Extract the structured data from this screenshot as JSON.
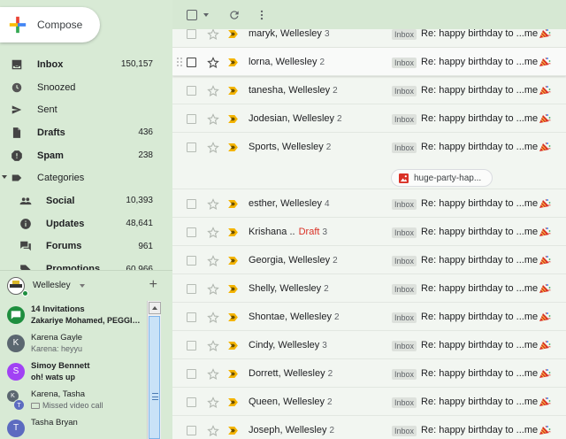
{
  "compose": {
    "label": "Compose"
  },
  "labels": [
    {
      "id": "inbox",
      "icon": "inbox-icon",
      "name": "Inbox",
      "count": "150,157",
      "bold": true
    },
    {
      "id": "snoozed",
      "icon": "clock-icon",
      "name": "Snoozed",
      "count": "",
      "bold": false
    },
    {
      "id": "sent",
      "icon": "send-icon",
      "name": "Sent",
      "count": "",
      "bold": false
    },
    {
      "id": "drafts",
      "icon": "draft-icon",
      "name": "Drafts",
      "count": "436",
      "bold": true
    },
    {
      "id": "spam",
      "icon": "spam-icon",
      "name": "Spam",
      "count": "238",
      "bold": true
    },
    {
      "id": "categories",
      "icon": "label-icon",
      "name": "Categories",
      "count": "",
      "bold": false
    },
    {
      "id": "social",
      "icon": "people-icon",
      "name": "Social",
      "count": "10,393",
      "bold": true,
      "sub": true
    },
    {
      "id": "updates",
      "icon": "info-icon",
      "name": "Updates",
      "count": "48,641",
      "bold": true,
      "sub": true
    },
    {
      "id": "forums",
      "icon": "forum-icon",
      "name": "Forums",
      "count": "961",
      "bold": true,
      "sub": true
    },
    {
      "id": "promotions",
      "icon": "tag-icon",
      "name": "Promotions",
      "count": "60,966",
      "bold": true,
      "sub": true
    }
  ],
  "chat": {
    "account_name": "Wellesley",
    "conversations": [
      {
        "type": "group",
        "title": "14 Invitations",
        "subtitle": "Zakariye Mohamed, PEGGI…",
        "bold": true,
        "color": "#1e8e3e",
        "initial": ""
      },
      {
        "type": "person",
        "title": "Karena Gayle",
        "subtitle": "Karena: heyyu",
        "bold": false,
        "color": "#5b6770",
        "initial": "K"
      },
      {
        "type": "person",
        "title": "Simoy Bennett",
        "subtitle": "oh! wats up",
        "bold": true,
        "color": "#a142f4",
        "initial": "S"
      },
      {
        "type": "pair",
        "title": "Karena, Tasha",
        "subtitle": "Missed video call",
        "bold": false,
        "initial": "K",
        "initial2": "T"
      },
      {
        "type": "person",
        "title": "Tasha Bryan",
        "subtitle": "",
        "bold": false,
        "color": "#5c6bc0",
        "initial": "T"
      }
    ]
  },
  "emails": [
    {
      "sender": "maryk, Wellesley",
      "count": "3",
      "draft": "",
      "tag": "Inbox",
      "subject": "Re: happy birthday to ...me",
      "hover": false
    },
    {
      "sender": "lorna, Wellesley",
      "count": "2",
      "draft": "",
      "tag": "Inbox",
      "subject": "Re: happy birthday to ...me",
      "hover": true
    },
    {
      "sender": "tanesha, Wellesley",
      "count": "2",
      "draft": "",
      "tag": "Inbox",
      "subject": "Re: happy birthday to ...me",
      "hover": false
    },
    {
      "sender": "Jodesian, Wellesley",
      "count": "2",
      "draft": "",
      "tag": "Inbox",
      "subject": "Re: happy birthday to ...me",
      "hover": false
    },
    {
      "sender": "Sports, Wellesley",
      "count": "2",
      "draft": "",
      "tag": "Inbox",
      "subject": "Re: happy birthday to ...me",
      "hover": false,
      "attachment": "huge-party-hap..."
    },
    {
      "sender": "esther, Wellesley",
      "count": "4",
      "draft": "",
      "tag": "Inbox",
      "subject": "Re: happy birthday to ...me",
      "hover": false
    },
    {
      "sender": "Krishana ..",
      "count": "3",
      "draft": "Draft",
      "tag": "Inbox",
      "subject": "Re: happy birthday to ...me",
      "hover": false
    },
    {
      "sender": "Georgia, Wellesley",
      "count": "2",
      "draft": "",
      "tag": "Inbox",
      "subject": "Re: happy birthday to ...me",
      "hover": false
    },
    {
      "sender": "Shelly, Wellesley",
      "count": "2",
      "draft": "",
      "tag": "Inbox",
      "subject": "Re: happy birthday to ...me",
      "hover": false
    },
    {
      "sender": "Shontae, Wellesley",
      "count": "2",
      "draft": "",
      "tag": "Inbox",
      "subject": "Re: happy birthday to ...me",
      "hover": false
    },
    {
      "sender": "Cindy, Wellesley",
      "count": "3",
      "draft": "",
      "tag": "Inbox",
      "subject": "Re: happy birthday to ...me",
      "hover": false
    },
    {
      "sender": "Dorrett, Wellesley",
      "count": "2",
      "draft": "",
      "tag": "Inbox",
      "subject": "Re: happy birthday to ...me",
      "hover": false
    },
    {
      "sender": "Queen, Wellesley",
      "count": "2",
      "draft": "",
      "tag": "Inbox",
      "subject": "Re: happy birthday to ...me",
      "hover": false
    },
    {
      "sender": "Joseph, Wellesley",
      "count": "2",
      "draft": "",
      "tag": "Inbox",
      "subject": "Re: happy birthday to ...me",
      "hover": false
    }
  ],
  "colors": {
    "background": "#d6e8d3",
    "list": "#f2f6f1",
    "important": "#f4b400",
    "draft": "#d93025"
  }
}
